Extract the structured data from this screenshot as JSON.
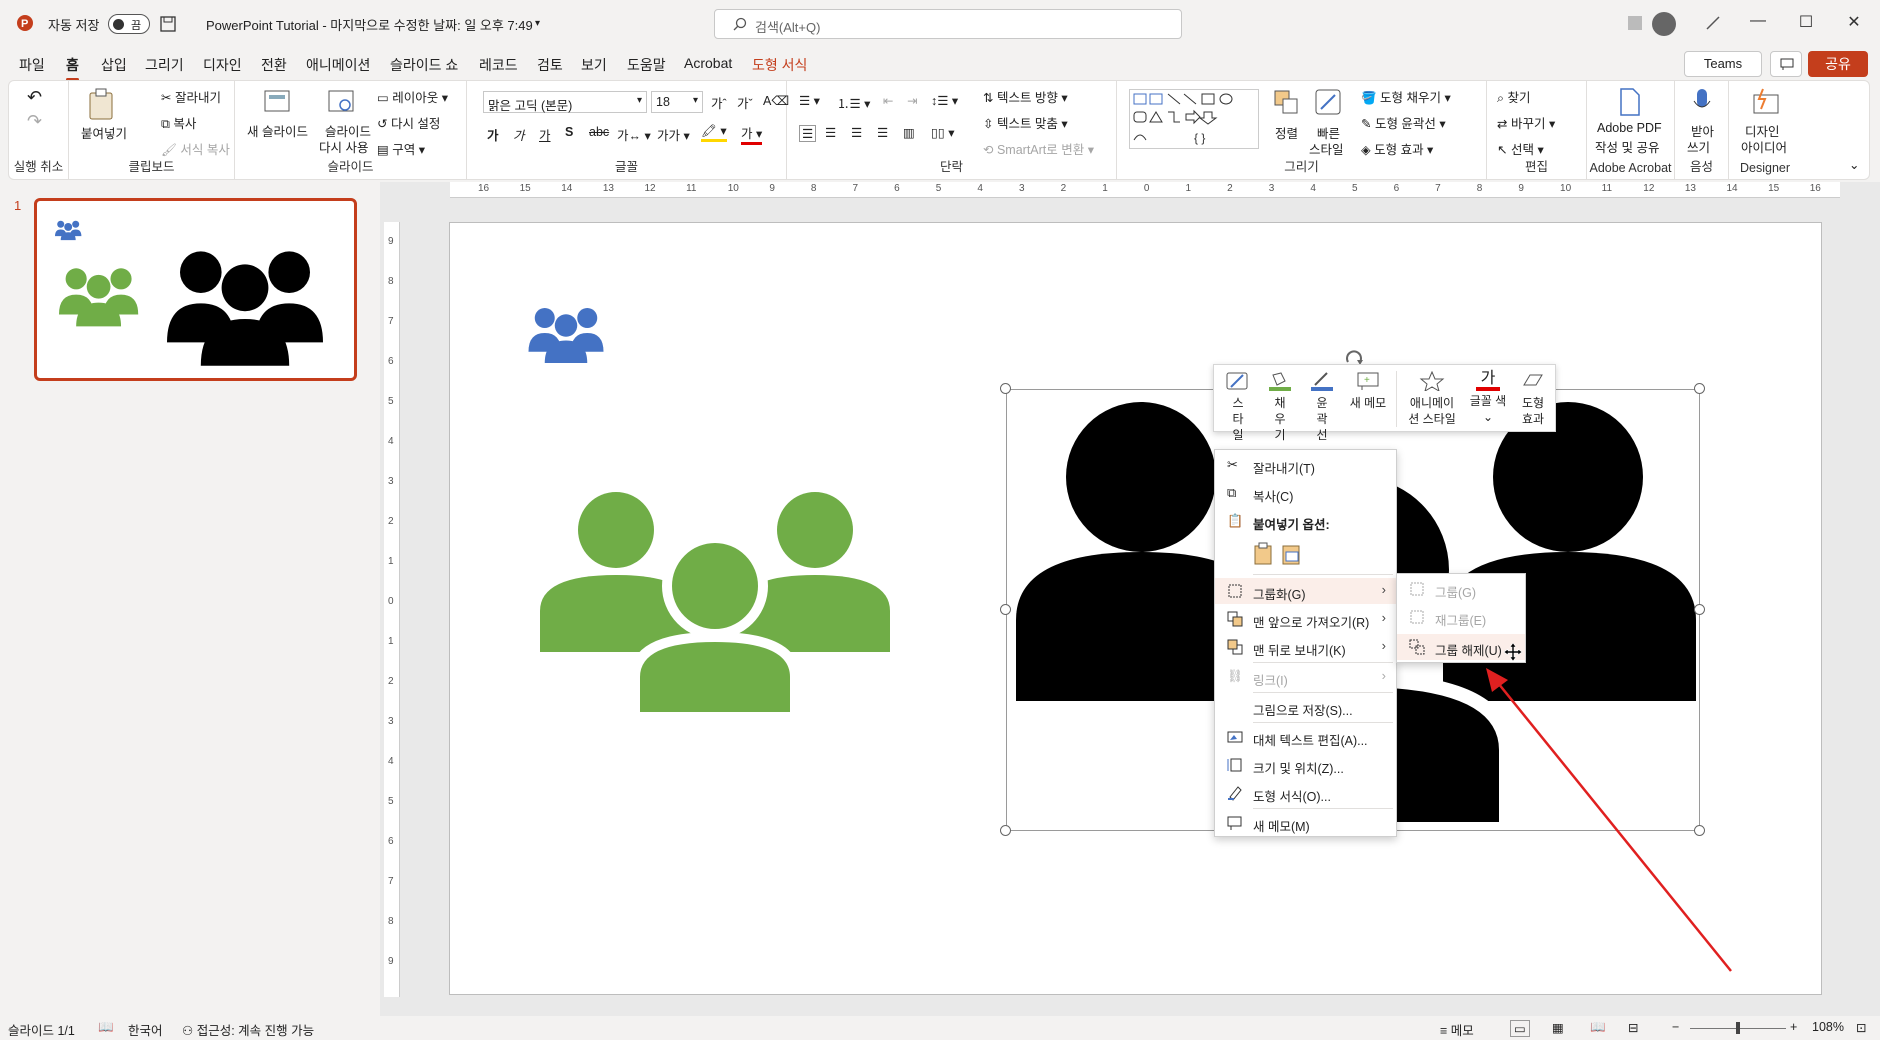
{
  "titlebar": {
    "autosave_label": "자동 저장",
    "autosave_state": "끔",
    "doc_title": "PowerPoint Tutorial  -  마지막으로 수정한 날짜: 일 오후 7:49",
    "search_placeholder": "검색(Alt+Q)"
  },
  "tabs": [
    "파일",
    "홈",
    "삽입",
    "그리기",
    "디자인",
    "전환",
    "애니메이션",
    "슬라이드 쇼",
    "레코드",
    "검토",
    "보기",
    "도움말",
    "Acrobat",
    "도형 서식"
  ],
  "header_buttons": {
    "teams": "Teams",
    "share": "공유"
  },
  "ribbon": {
    "undo": {
      "group": "실행 취소"
    },
    "clipboard": {
      "group": "클립보드",
      "paste": "붙여넣기",
      "cut": "잘라내기",
      "copy": "복사",
      "format_painter": "서식 복사"
    },
    "slides": {
      "group": "슬라이드",
      "new_slide": "새 슬라이드",
      "reuse_line1": "슬라이드",
      "reuse_line2": "다시 사용",
      "layout": "레이아웃",
      "reset": "다시 설정",
      "section": "구역"
    },
    "font": {
      "group": "글꼴",
      "font_name": "맑은 고딕 (본문)",
      "font_size": "18"
    },
    "paragraph": {
      "group": "단락",
      "text_direction": "텍스트 방향",
      "align_text": "텍스트 맞춤",
      "smartart": "SmartArt로 변환"
    },
    "drawing": {
      "group": "그리기",
      "arrange": "정렬",
      "quick_styles_line1": "빠른",
      "quick_styles_line2": "스타일",
      "shape_fill": "도형 채우기",
      "shape_outline": "도형 윤곽선",
      "shape_effects": "도형 효과"
    },
    "editing": {
      "group": "편집",
      "find": "찾기",
      "replace": "바꾸기",
      "select": "선택"
    },
    "acrobat": {
      "group": "Adobe Acrobat",
      "line1": "Adobe PDF",
      "line2": "작성 및 공유"
    },
    "voice": {
      "group": "음성",
      "line1": "받아",
      "line2": "쓰기"
    },
    "designer": {
      "group": "Designer",
      "line1": "디자인",
      "line2": "아이디어"
    }
  },
  "thumbnail": {
    "number": "1"
  },
  "mini_toolbar": {
    "style": "스타일",
    "fill": "채우기",
    "outline": "윤곽선",
    "new_comment": "새 메모",
    "animation_style_line1": "애니메이",
    "animation_style_line2": "션 스타일",
    "font_color_glyph": "가",
    "font_color": "글꼴 색",
    "shape_effects_line1": "도형",
    "shape_effects_line2": "효과"
  },
  "context_menu": {
    "cut": "잘라내기(T)",
    "copy": "복사(C)",
    "paste_options": "붙여넣기 옵션:",
    "group": "그룹화(G)",
    "bring_forward": "맨 앞으로 가져오기(R)",
    "send_backward": "맨 뒤로 보내기(K)",
    "link": "링크(I)",
    "save_as_picture": "그림으로 저장(S)...",
    "edit_alt_text": "대체 텍스트 편집(A)...",
    "size_position": "크기 및 위치(Z)...",
    "format_shape": "도형 서식(O)...",
    "new_comment": "새 메모(M)"
  },
  "submenu": {
    "group": "그룹(G)",
    "regroup": "재그룹(E)",
    "ungroup": "그룹 해제(U)"
  },
  "statusbar": {
    "slide_info": "슬라이드 1/1",
    "language": "한국어",
    "accessibility": "접근성: 계속 진행 가능",
    "notes": "메모",
    "zoom": "108%"
  },
  "ruler": {
    "h_ticks": [
      "16",
      "15",
      "14",
      "13",
      "12",
      "11",
      "10",
      "9",
      "8",
      "7",
      "6",
      "5",
      "4",
      "3",
      "2",
      "1",
      "0",
      "1",
      "2",
      "3",
      "4",
      "5",
      "6",
      "7",
      "8",
      "9",
      "10",
      "11",
      "12",
      "13",
      "14",
      "15",
      "16"
    ],
    "v_ticks": [
      "9",
      "8",
      "7",
      "6",
      "5",
      "4",
      "3",
      "2",
      "1",
      "0",
      "1",
      "2",
      "3",
      "4",
      "5",
      "6",
      "7",
      "8",
      "9"
    ]
  },
  "colors": {
    "accent": "#c43e1c",
    "green_icon": "#70ad47",
    "blue_icon": "#4472c4",
    "arrow": "#e02020"
  }
}
